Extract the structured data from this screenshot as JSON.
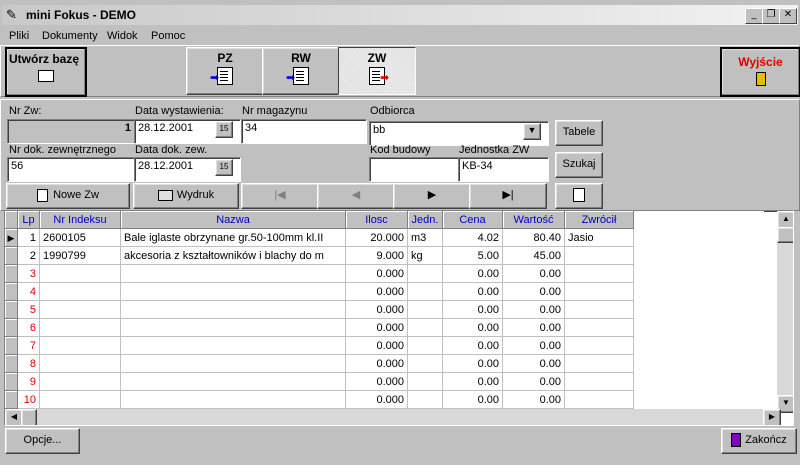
{
  "window": {
    "title": "mini Fokus - DEMO",
    "minimize": "_",
    "restore": "❐",
    "close": "✕"
  },
  "menu": [
    "Pliki",
    "Dokumenty",
    "Widok",
    "Pomoc"
  ],
  "toolbar": {
    "create_db": "Utwórz bazę",
    "pz": "PZ",
    "rw": "RW",
    "zw": "ZW",
    "exit": "Wyjście"
  },
  "form": {
    "nr_zw_label": "Nr Zw:",
    "nr_zw_value": "1",
    "data_wyst_label": "Data wystawienia:",
    "data_wyst_value": "28.12.2001",
    "nr_mag_label": "Nr magazynu",
    "nr_mag_value": "34",
    "odbiorca_label": "Odbiorca",
    "odbiorca_value": "bb",
    "nr_dok_label": "Nr dok. zewnętrznego",
    "nr_dok_value": "56",
    "data_dok_label": "Data dok. zew.",
    "data_dok_value": "28.12.2001",
    "kod_budowy_label": "Kod budowy",
    "kod_budowy_value": "",
    "jednostka_label": "Jednostka ZW",
    "jednostka_value": "KB-34",
    "cal_icon": "15",
    "tabele": "Tabele",
    "szukaj": "Szukaj"
  },
  "actions": {
    "nowe_zw": "Nowe Zw",
    "wydruk": "Wydruk",
    "first": "|◀",
    "prev": "◀",
    "next": "▶",
    "last": "▶|"
  },
  "grid": {
    "columns": [
      "Lp",
      "Nr Indeksu",
      "Nazwa",
      "Ilosc",
      "Jedn.",
      "Cena",
      "Wartość",
      "Zwrócił"
    ],
    "rows": [
      [
        "1",
        "2600105",
        "Bale iglaste obrzynane gr.50-100mm kl.II",
        "20.000",
        "m3",
        "4.02",
        "80.40",
        "Jasio"
      ],
      [
        "2",
        "1990799",
        "akcesoria z kształtowników i blachy do m",
        "9.000",
        "kg",
        "5.00",
        "45.00",
        ""
      ],
      [
        "3",
        "",
        "",
        "0.000",
        "",
        "0.00",
        "0.00",
        ""
      ],
      [
        "4",
        "",
        "",
        "0.000",
        "",
        "0.00",
        "0.00",
        ""
      ],
      [
        "5",
        "",
        "",
        "0.000",
        "",
        "0.00",
        "0.00",
        ""
      ],
      [
        "6",
        "",
        "",
        "0.000",
        "",
        "0.00",
        "0.00",
        ""
      ],
      [
        "7",
        "",
        "",
        "0.000",
        "",
        "0.00",
        "0.00",
        ""
      ],
      [
        "8",
        "",
        "",
        "0.000",
        "",
        "0.00",
        "0.00",
        ""
      ],
      [
        "9",
        "",
        "",
        "0.000",
        "",
        "0.00",
        "0.00",
        ""
      ],
      [
        "10",
        "",
        "",
        "0.000",
        "",
        "0.00",
        "0.00",
        ""
      ]
    ]
  },
  "footer": {
    "opcje": "Opcje...",
    "zakoncz": "Zakończ"
  }
}
